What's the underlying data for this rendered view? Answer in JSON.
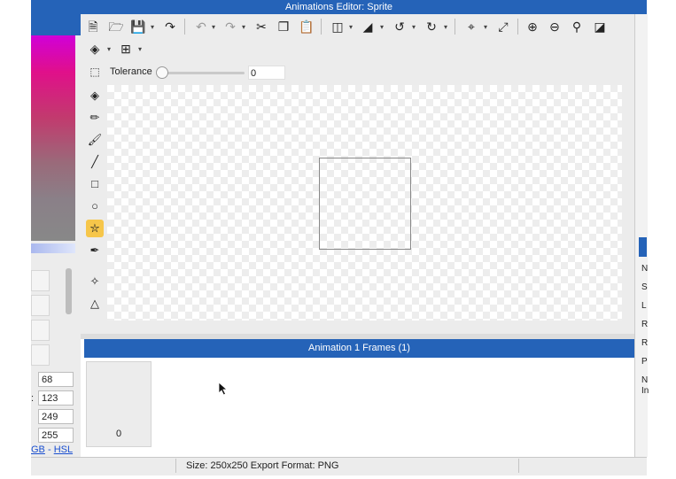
{
  "window": {
    "title": "Animations Editor: Sprite"
  },
  "toolbar": {
    "row1_icons": [
      "new-file-icon",
      "open-folder-icon",
      "save-icon",
      "export-icon",
      "undo-icon",
      "redo-icon",
      "cut-icon",
      "copy-icon",
      "paste-icon",
      "flip-horizontal-icon",
      "flip-vertical-icon",
      "rotate-left-icon",
      "rotate-right-icon",
      "crop-icon",
      "resize-icon",
      "zoom-in-icon",
      "zoom-out-icon",
      "zoom-fit-icon",
      "invert-icon"
    ],
    "row2_icons": [
      "layers-icon",
      "grid-icon"
    ],
    "tolerance_label": "Tolerance",
    "tolerance_value": "0",
    "tolerance_level": 0
  },
  "tools": [
    "eraser-icon",
    "pencil-icon",
    "brush-icon",
    "line-icon",
    "rectangle-icon",
    "ellipse-icon",
    "fill-bucket-icon",
    "eyedropper-icon",
    "node-icon",
    "path-icon"
  ],
  "selected_tool": "fill-bucket-icon",
  "color_panel": {
    "values": [
      "68",
      "123",
      "249",
      "255"
    ],
    "mode_links": {
      "rgb": "RGB",
      "separator": " - ",
      "hsl": "HSL"
    },
    "rgb_prefix": "",
    "rgb_link_visible": "GB"
  },
  "right_panel_letters": [
    "N",
    "S",
    "L",
    "R",
    "R",
    "P",
    "N",
    "In"
  ],
  "frames_panel": {
    "header": "Animation 1 Frames (1)",
    "frames": [
      {
        "label": "0"
      }
    ]
  },
  "status_bar": {
    "text": "Size: 250x250  Export Format: PNG"
  },
  "colors": {
    "accent": "#2563b8",
    "selected_tool_bg": "#f6c64a"
  }
}
